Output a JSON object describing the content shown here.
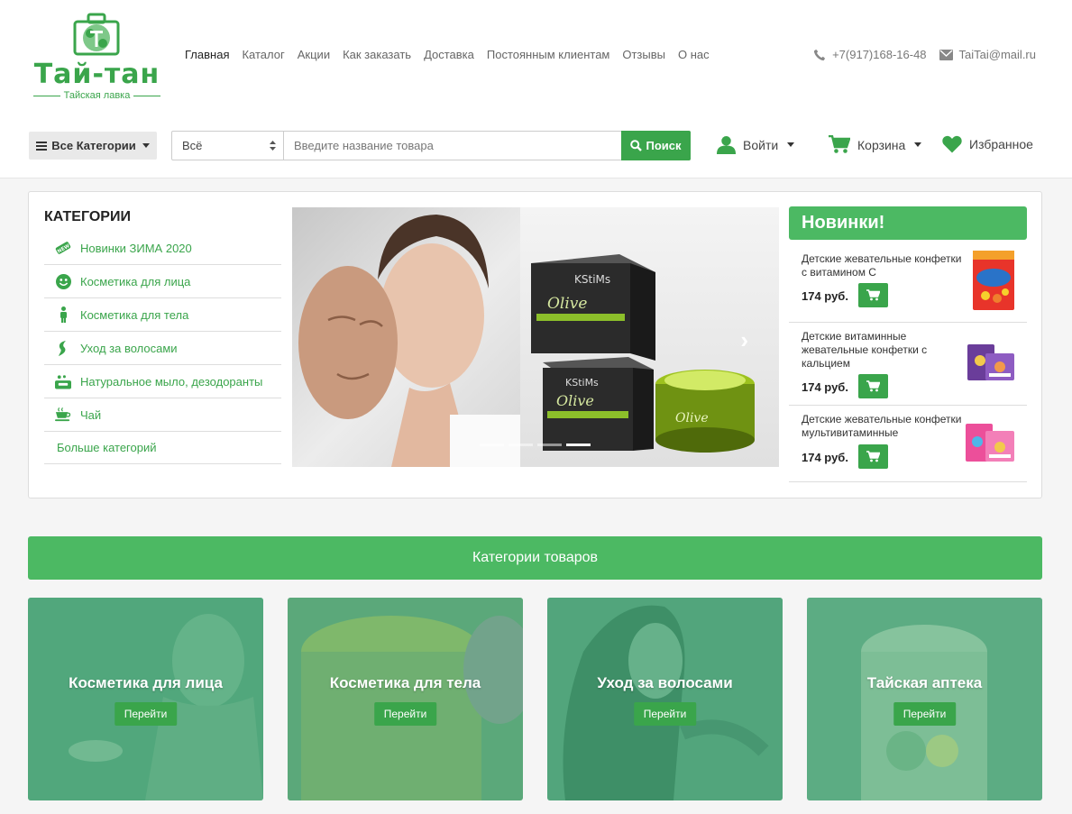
{
  "logo": {
    "name": "Тай-тан",
    "tagline": "Тайская лавка"
  },
  "nav": [
    "Главная",
    "Каталог",
    "Акции",
    "Как заказать",
    "Доставка",
    "Постоянным клиентам",
    "Отзывы",
    "О нас"
  ],
  "contacts": {
    "phone": "+7(917)168-16-48",
    "email": "TaiTai@mail.ru"
  },
  "toolbar": {
    "all_categories": "Все Категории",
    "search_scope": "Всё",
    "search_placeholder": "Введите название товара",
    "search_button": "Поиск",
    "login": "Войти",
    "cart": "Корзина",
    "favorites": "Избранное"
  },
  "sidebar": {
    "title": "КАТЕГОРИИ",
    "items": [
      {
        "label": "Новинки ЗИМА 2020",
        "icon": "new-badge-icon"
      },
      {
        "label": "Косметика для лица",
        "icon": "smile-icon"
      },
      {
        "label": "Косметика для тела",
        "icon": "person-icon"
      },
      {
        "label": "Уход за волосами",
        "icon": "hair-icon"
      },
      {
        "label": "Натуральное мыло, дезодоранты",
        "icon": "soap-icon"
      },
      {
        "label": "Чай",
        "icon": "tea-cup-icon"
      }
    ],
    "more": "Больше категорий"
  },
  "new_products": {
    "title": "Новинки!",
    "items": [
      {
        "name": "Детские жевательные конфетки с витамином С",
        "price": "174 руб."
      },
      {
        "name": "Детские витаминные жевательные конфетки с кальцием",
        "price": "174 руб."
      },
      {
        "name": "Детские жевательные конфетки мультивитаминные",
        "price": "174 руб."
      }
    ]
  },
  "categories": {
    "title": "Категории товаров",
    "button": "Перейти",
    "tiles": [
      {
        "label": "Косметика для лица"
      },
      {
        "label": "Косметика для тела"
      },
      {
        "label": "Уход за волосами"
      },
      {
        "label": "Тайская аптека"
      }
    ]
  },
  "colors": {
    "brand": "#3aa54b",
    "accent": "#4cb963"
  }
}
